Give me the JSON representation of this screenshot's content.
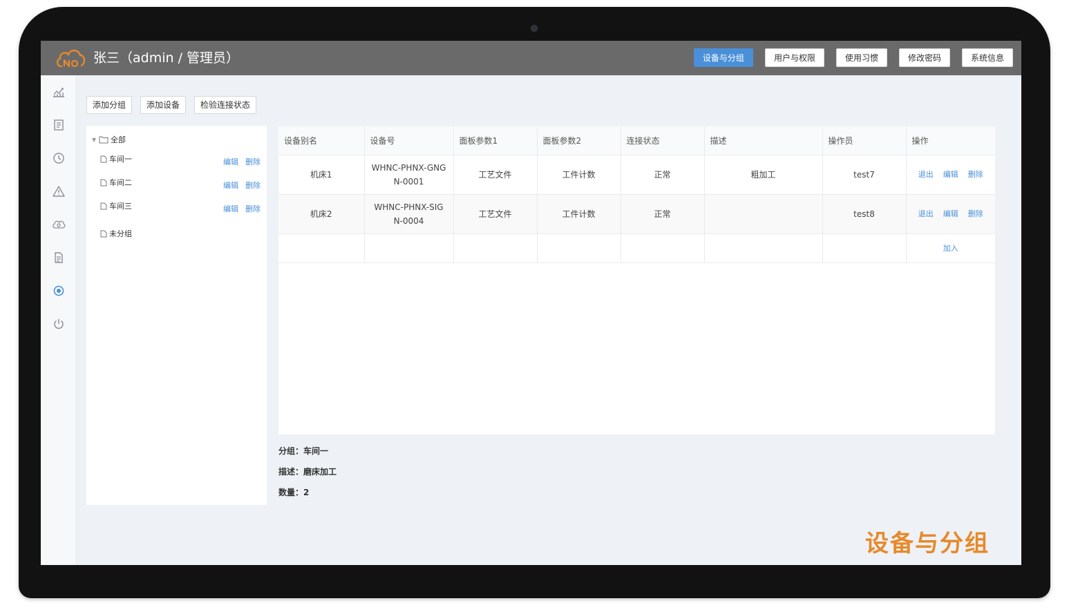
{
  "header": {
    "user_title": "张三（admin / 管理员）",
    "nav": [
      {
        "label": "设备与分组",
        "active": true
      },
      {
        "label": "用户与权限",
        "active": false
      },
      {
        "label": "使用习惯",
        "active": false
      },
      {
        "label": "修改密码",
        "active": false
      },
      {
        "label": "系统信息",
        "active": false
      }
    ]
  },
  "sidebar": {
    "icons": [
      "chart-line-icon",
      "document-list-icon",
      "clock-icon",
      "warning-icon",
      "cloud-icon",
      "file-icon",
      "settings-icon",
      "power-icon"
    ],
    "active_icon": "settings-icon"
  },
  "actions": {
    "add_group": "添加分组",
    "add_device": "添加设备",
    "check_connection": "检验连接状态"
  },
  "tree": {
    "root": "全部",
    "groups": [
      {
        "name": "车间一",
        "edit": "编辑",
        "delete": "删除"
      },
      {
        "name": "车间二",
        "edit": "编辑",
        "delete": "删除"
      },
      {
        "name": "车间三",
        "edit": "编辑",
        "delete": "删除"
      }
    ],
    "ungrouped": "未分组"
  },
  "table": {
    "columns": [
      "设备别名",
      "设备号",
      "面板参数1",
      "面板参数2",
      "连接状态",
      "描述",
      "操作员",
      "操作"
    ],
    "rows": [
      {
        "alias": "机床1",
        "device_no": "WHNC-PHNX-GNGN-0001",
        "param1": "工艺文件",
        "param2": "工件计数",
        "status": "正常",
        "desc": "粗加工",
        "operator": "test7",
        "op_exit": "退出",
        "op_edit": "编辑",
        "op_delete": "删除"
      },
      {
        "alias": "机床2",
        "device_no": "WHNC-PHNX-SIGN-0004",
        "param1": "工艺文件",
        "param2": "工件计数",
        "status": "正常",
        "desc": "",
        "operator": "test8",
        "op_exit": "退出",
        "op_edit": "编辑",
        "op_delete": "删除"
      }
    ],
    "add_label": "加入"
  },
  "info": {
    "group": "分组：车间一",
    "desc": "描述：磨床加工",
    "count": "数量：2"
  },
  "caption": "设备与分组",
  "colors": {
    "accent": "#4a90d9",
    "topbar": "#6a6a6a",
    "caption": "#e8892a",
    "logo": "#e8892a"
  }
}
